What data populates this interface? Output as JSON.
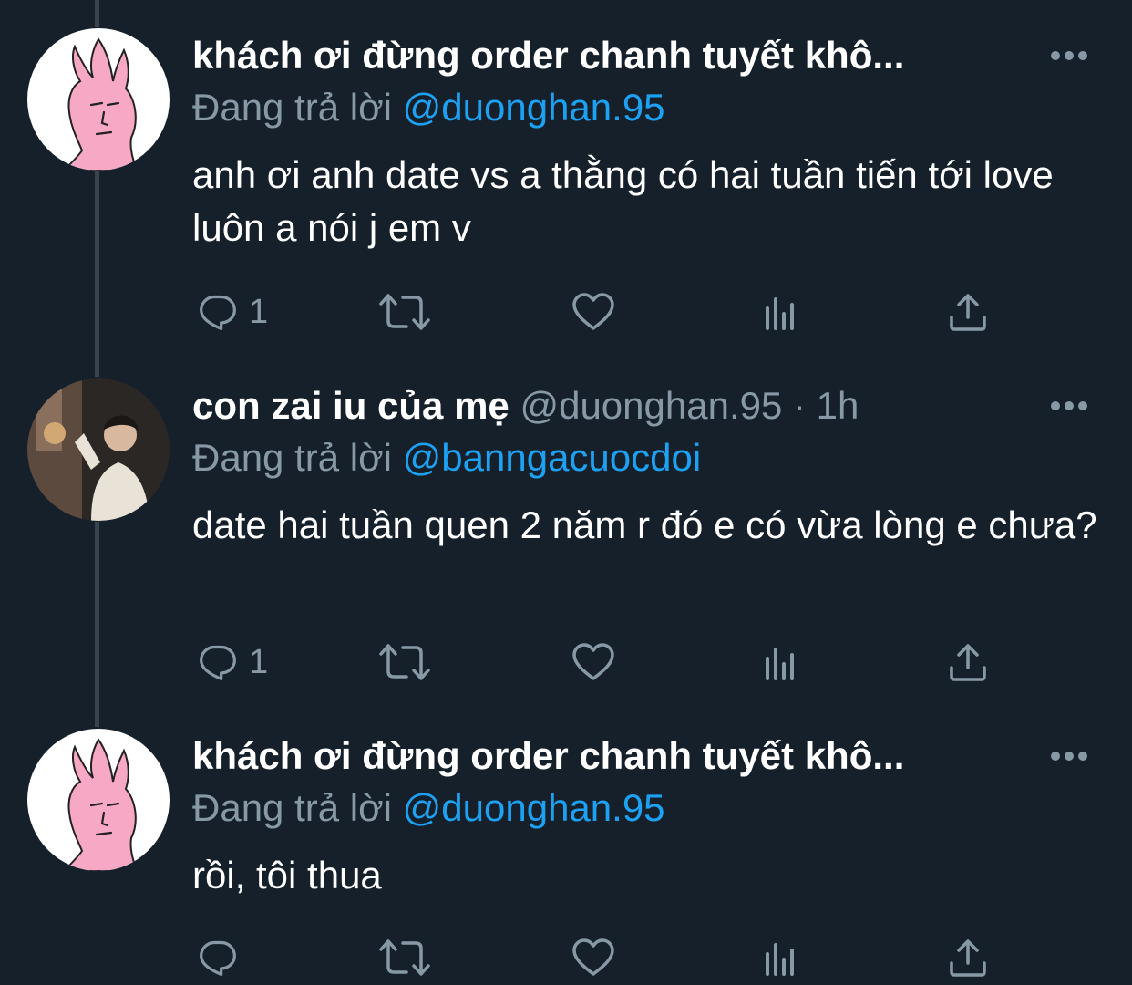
{
  "colors": {
    "background": "#15202b",
    "primary_text": "#ffffff",
    "secondary_text": "#8899a6",
    "mention": "#1da1f2",
    "thread_line": "#38444d"
  },
  "reply_prefix": "Đang trả lời",
  "tweets": [
    {
      "display_name": "khách ơi đừng order chanh tuyết khô...",
      "handle": "",
      "time": "",
      "reply_to": "@duonghan.95",
      "text": "anh ơi anh date vs a thằng có hai tuần tiến tới love luôn a nói j em v",
      "avatar": "pink-bunny-avatar",
      "reply_count": "1"
    },
    {
      "display_name": "con zai iu của mẹ",
      "handle": "@duonghan.95",
      "separator": "·",
      "time": "1h",
      "reply_to": "@banngacuocdoi",
      "text": "date hai tuần quen 2 năm r đó e có vừa lòng e chưa?",
      "avatar": "photo-avatar",
      "reply_count": "1"
    },
    {
      "display_name": "khách ơi đừng order chanh tuyết khô...",
      "handle": "",
      "time": "",
      "reply_to": "@duonghan.95",
      "text": "rồi, tôi thua",
      "avatar": "pink-bunny-avatar",
      "reply_count": ""
    }
  ],
  "icons": {
    "reply": "reply-icon",
    "retweet": "retweet-icon",
    "like": "heart-icon",
    "analytics": "analytics-icon",
    "share": "share-icon",
    "more": "more-icon"
  }
}
